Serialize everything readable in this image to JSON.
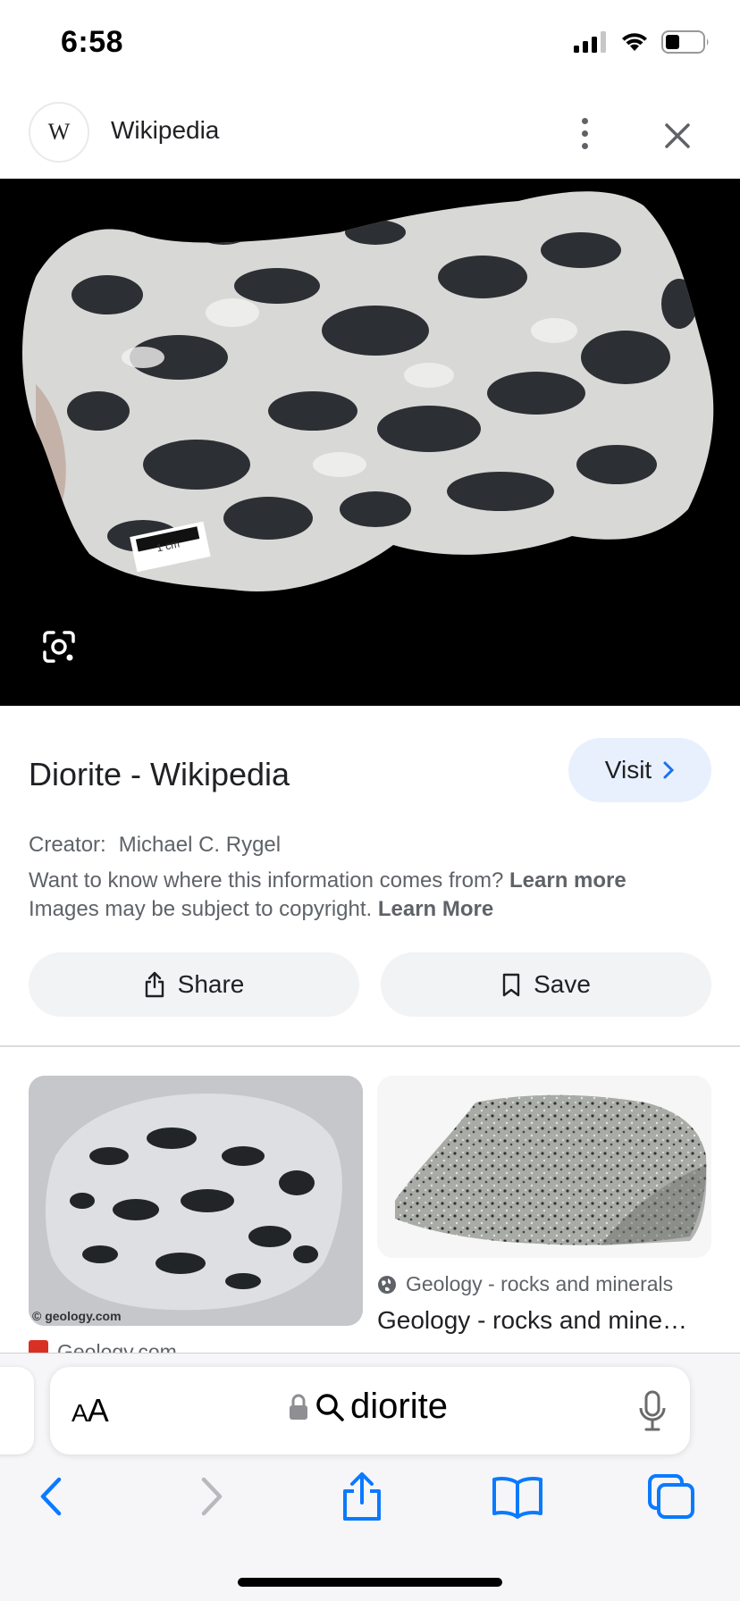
{
  "status_bar": {
    "time": "6:58",
    "icons": [
      "signal-icon",
      "wifi-icon",
      "battery-icon"
    ]
  },
  "header": {
    "logo_text": "W",
    "title": "Wikipedia",
    "more_icon": "more-vertical-icon",
    "close_icon": "close-icon"
  },
  "main_image": {
    "scale_label": "1 cm",
    "lens_icon": "google-lens-icon"
  },
  "result": {
    "title": "Diorite - Wikipedia",
    "visit_label": "Visit",
    "creator_label": "Creator:",
    "creator_name": "Michael C. Rygel",
    "info_text": "Want to know where this information comes from?",
    "info_link": "Learn more",
    "copyright_text": "Images may be subject to copyright.",
    "copyright_link": "Learn More",
    "share_label": "Share",
    "save_label": "Save"
  },
  "related": [
    {
      "watermark": "© geology.com",
      "source": "Geology.com",
      "source_icon": "geology-favicon"
    },
    {
      "source": "Geology - rocks and minerals",
      "source_icon": "globe-icon",
      "title": "Geology - rocks and mine…"
    }
  ],
  "safari": {
    "text_size_label_big": "A",
    "text_size_label_small": "A",
    "url": "diorite",
    "lock_icon": "lock-icon",
    "search_icon": "search-icon",
    "mic_icon": "microphone-icon",
    "toolbar": [
      "back-icon",
      "forward-icon",
      "share-icon",
      "bookmarks-icon",
      "tabs-icon"
    ]
  },
  "colors": {
    "accent": "#1a73e8",
    "safari_blue": "#0a7aff",
    "visit_bg": "#e8f0fe",
    "button_bg": "#f1f3f4"
  }
}
